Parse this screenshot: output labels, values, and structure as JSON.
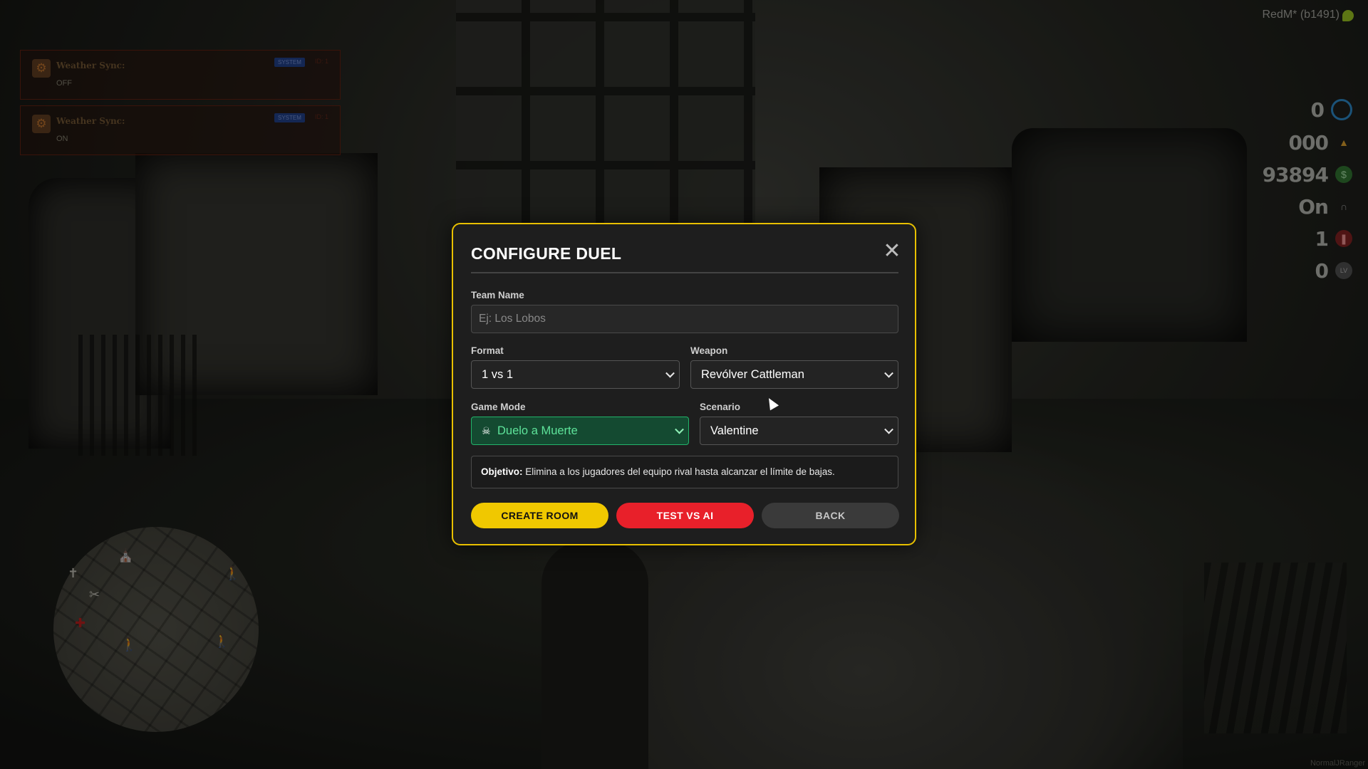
{
  "notifications": [
    {
      "title": "Weather Sync:",
      "value": "OFF",
      "badge": "SYSTEM",
      "id": "ID: 1"
    },
    {
      "title": "Weather Sync:",
      "value": "ON",
      "badge": "SYSTEM",
      "id": "ID: 1"
    }
  ],
  "hud": {
    "version": "RedM* (b1491)",
    "stats": [
      {
        "value": "0",
        "icon": "target-icon",
        "color": "#2a7fb8"
      },
      {
        "value": "000",
        "icon": "gold-icon",
        "color": "#c9922a"
      },
      {
        "value": "93894",
        "icon": "dollar-icon",
        "color": "#3a8a3a"
      },
      {
        "value": "On",
        "icon": "horseshoe-icon",
        "color": "#8a8a8a"
      },
      {
        "value": "1",
        "icon": "ammo-icon",
        "color": "#a83030"
      },
      {
        "value": "0",
        "icon": "level-icon",
        "color": "#7a7a7a"
      }
    ]
  },
  "modal": {
    "title": "CONFIGURE DUEL",
    "team_name": {
      "label": "Team Name",
      "placeholder": "Ej: Los Lobos",
      "value": ""
    },
    "format": {
      "label": "Format",
      "selected": "1 vs 1"
    },
    "weapon": {
      "label": "Weapon",
      "selected": "Revólver Cattleman"
    },
    "game_mode": {
      "label": "Game Mode",
      "selected": "Duelo a Muerte",
      "icon": "skull-icon"
    },
    "scenario": {
      "label": "Scenario",
      "selected": "Valentine"
    },
    "objective": {
      "label": "Objetivo:",
      "text": "Elimina a los jugadores del equipo rival hasta alcanzar el límite de bajas."
    },
    "buttons": {
      "create": "CREATE ROOM",
      "test": "TEST VS AI",
      "back": "BACK"
    }
  },
  "colors": {
    "accent": "#f0c800",
    "danger": "#e8202a",
    "success": "#22b36a"
  },
  "watermark": "NormalJRanger"
}
